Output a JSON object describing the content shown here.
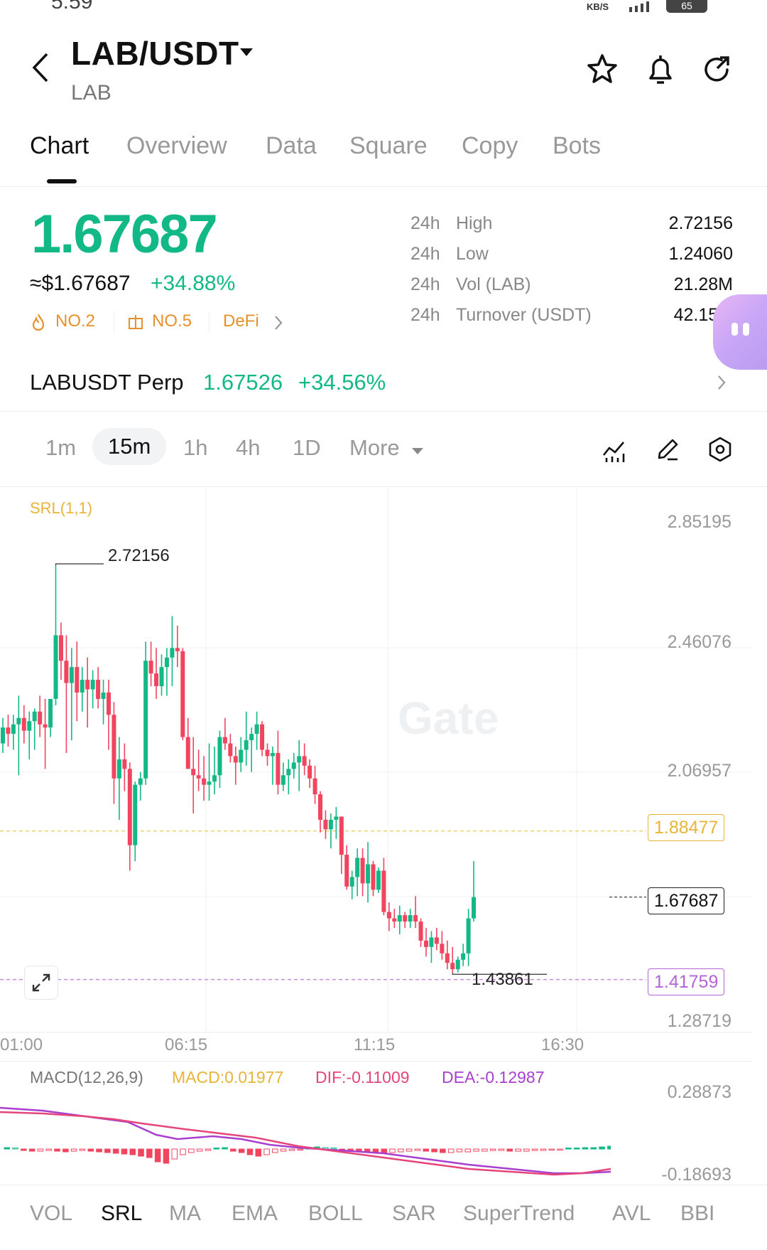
{
  "status_bar": {
    "time": "5:59",
    "network": "KB/S",
    "battery": "65"
  },
  "header": {
    "pair": "LAB/USDT",
    "base": "LAB",
    "icons": [
      "back-arrow-icon",
      "star-icon",
      "bell-icon",
      "share-icon"
    ]
  },
  "tabs": [
    "Chart",
    "Overview",
    "Data",
    "Square",
    "Copy",
    "Bots"
  ],
  "active_tab": "Chart",
  "ticker": {
    "price": "1.67687",
    "usd_price": "≈$1.67687",
    "change": "+34.88%",
    "ranks": [
      "NO.2",
      "NO.5",
      "DeFi"
    ],
    "stats": [
      {
        "period": "24h",
        "label": "High",
        "value": "2.72156"
      },
      {
        "period": "24h",
        "label": "Low",
        "value": "1.24060"
      },
      {
        "period": "24h",
        "label": "Vol (LAB)",
        "value": "21.28M"
      },
      {
        "period": "24h",
        "label": "Turnover (USDT)",
        "value": "42.15M"
      }
    ]
  },
  "perp": {
    "name": "LABUSDT Perp",
    "price": "1.67526",
    "change": "+34.56%"
  },
  "intervals": [
    "1m",
    "15m",
    "1h",
    "4h",
    "1D",
    "More"
  ],
  "active_interval": "15m",
  "chart": {
    "indicator": "SRL(1,1)",
    "y_ticks": [
      "2.85195",
      "2.46076",
      "2.06957",
      "1.28719"
    ],
    "x_ticks": [
      "01:00",
      "06:15",
      "11:15",
      "16:30"
    ],
    "tags": {
      "srl_upper": "1.88477",
      "last": "1.67687",
      "srl_lower": "1.41759"
    },
    "annotations": {
      "high": "2.72156",
      "low": "1.43861"
    },
    "watermark": "Gate"
  },
  "chart_data": {
    "type": "candlestick",
    "ylim": [
      1.28719,
      2.85195
    ],
    "x_ticks": [
      "01:00",
      "06:15",
      "11:15",
      "16:30"
    ],
    "colors": {
      "up": "#12b886",
      "down": "#f0445f"
    },
    "candles": [
      [
        2.16,
        2.24,
        2.13,
        2.21
      ],
      [
        2.21,
        2.25,
        2.15,
        2.19
      ],
      [
        2.19,
        2.25,
        2.14,
        2.22
      ],
      [
        2.22,
        2.31,
        2.06,
        2.24
      ],
      [
        2.24,
        2.28,
        2.16,
        2.2
      ],
      [
        2.2,
        2.26,
        2.11,
        2.23
      ],
      [
        2.23,
        2.27,
        2.14,
        2.26
      ],
      [
        2.26,
        2.31,
        2.18,
        2.22
      ],
      [
        2.22,
        2.3,
        2.08,
        2.21
      ],
      [
        2.21,
        2.26,
        2.18,
        2.3
      ],
      [
        2.3,
        2.72,
        2.28,
        2.5
      ],
      [
        2.5,
        2.54,
        2.36,
        2.42
      ],
      [
        2.42,
        2.5,
        2.13,
        2.35
      ],
      [
        2.35,
        2.46,
        2.17,
        2.4
      ],
      [
        2.4,
        2.48,
        2.23,
        2.32
      ],
      [
        2.32,
        2.4,
        2.26,
        2.36
      ],
      [
        2.36,
        2.43,
        2.21,
        2.33
      ],
      [
        2.33,
        2.39,
        2.27,
        2.36
      ],
      [
        2.36,
        2.4,
        2.27,
        2.3
      ],
      [
        2.3,
        2.36,
        2.22,
        2.32
      ],
      [
        2.32,
        2.36,
        2.14,
        2.25
      ],
      [
        2.25,
        2.29,
        1.97,
        2.05
      ],
      [
        2.05,
        2.18,
        1.92,
        2.11
      ],
      [
        2.11,
        2.16,
        2.01,
        2.08
      ],
      [
        2.08,
        2.1,
        1.76,
        1.84
      ],
      [
        1.84,
        2.04,
        1.79,
        2.03
      ],
      [
        2.03,
        2.07,
        1.98,
        2.05
      ],
      [
        2.05,
        2.48,
        2.03,
        2.42
      ],
      [
        2.42,
        2.48,
        2.34,
        2.38
      ],
      [
        2.38,
        2.46,
        2.3,
        2.34
      ],
      [
        2.34,
        2.44,
        2.31,
        2.4
      ],
      [
        2.4,
        2.46,
        2.31,
        2.43
      ],
      [
        2.43,
        2.56,
        2.34,
        2.46
      ],
      [
        2.46,
        2.53,
        2.4,
        2.45
      ],
      [
        2.45,
        2.46,
        2.17,
        2.18
      ],
      [
        2.18,
        2.24,
        2.08,
        2.08
      ],
      [
        2.08,
        2.18,
        1.94,
        2.06
      ],
      [
        2.06,
        2.14,
        2.01,
        2.05
      ],
      [
        2.05,
        2.12,
        1.98,
        2.03
      ],
      [
        2.03,
        2.16,
        1.98,
        2.04
      ],
      [
        2.04,
        2.15,
        2.0,
        2.06
      ],
      [
        2.06,
        2.2,
        2.02,
        2.18
      ],
      [
        2.18,
        2.24,
        2.14,
        2.16
      ],
      [
        2.16,
        2.19,
        2.1,
        2.12
      ],
      [
        2.12,
        2.15,
        2.03,
        2.1
      ],
      [
        2.1,
        2.18,
        2.07,
        2.14
      ],
      [
        2.14,
        2.26,
        2.09,
        2.17
      ],
      [
        2.17,
        2.21,
        2.07,
        2.19
      ],
      [
        2.19,
        2.26,
        2.14,
        2.22
      ],
      [
        2.22,
        2.23,
        2.12,
        2.14
      ],
      [
        2.14,
        2.16,
        2.09,
        2.12
      ],
      [
        2.12,
        2.15,
        2.03,
        2.13
      ],
      [
        2.13,
        2.2,
        2.0,
        2.03
      ],
      [
        2.03,
        2.1,
        2.01,
        2.06
      ],
      [
        2.06,
        2.11,
        2.0,
        2.08
      ],
      [
        2.08,
        2.13,
        2.05,
        2.1
      ],
      [
        2.1,
        2.17,
        2.01,
        2.12
      ],
      [
        2.12,
        2.16,
        2.06,
        2.09
      ],
      [
        2.09,
        2.11,
        2.02,
        2.05
      ],
      [
        2.05,
        2.09,
        1.97,
        2.0
      ],
      [
        2.0,
        2.01,
        1.88,
        1.92
      ],
      [
        1.92,
        1.95,
        1.86,
        1.89
      ],
      [
        1.89,
        1.94,
        1.83,
        1.92
      ],
      [
        1.92,
        1.96,
        1.86,
        1.93
      ],
      [
        1.93,
        1.93,
        1.75,
        1.81
      ],
      [
        1.81,
        1.84,
        1.7,
        1.71
      ],
      [
        1.71,
        1.76,
        1.67,
        1.74
      ],
      [
        1.74,
        1.83,
        1.68,
        1.8
      ],
      [
        1.8,
        1.83,
        1.68,
        1.72
      ],
      [
        1.72,
        1.85,
        1.66,
        1.78
      ],
      [
        1.78,
        1.79,
        1.68,
        1.7
      ],
      [
        1.7,
        1.77,
        1.69,
        1.76
      ],
      [
        1.76,
        1.8,
        1.62,
        1.63
      ],
      [
        1.63,
        1.66,
        1.57,
        1.61
      ],
      [
        1.61,
        1.64,
        1.58,
        1.6
      ],
      [
        1.6,
        1.65,
        1.56,
        1.62
      ],
      [
        1.62,
        1.63,
        1.58,
        1.6
      ],
      [
        1.6,
        1.64,
        1.58,
        1.62
      ],
      [
        1.62,
        1.68,
        1.58,
        1.6
      ],
      [
        1.6,
        1.61,
        1.52,
        1.54
      ],
      [
        1.54,
        1.58,
        1.49,
        1.52
      ],
      [
        1.52,
        1.57,
        1.47,
        1.55
      ],
      [
        1.55,
        1.58,
        1.51,
        1.53
      ],
      [
        1.53,
        1.57,
        1.48,
        1.5
      ],
      [
        1.5,
        1.54,
        1.45,
        1.47
      ],
      [
        1.47,
        1.52,
        1.43861,
        1.45
      ],
      [
        1.45,
        1.49,
        1.44,
        1.48
      ],
      [
        1.48,
        1.53,
        1.46,
        1.5
      ],
      [
        1.5,
        1.64,
        1.46,
        1.61
      ],
      [
        1.61,
        1.79,
        1.6,
        1.67687
      ]
    ],
    "srl_levels": [
      1.88477,
      1.41759
    ],
    "last_price": 1.67687
  },
  "macd": {
    "label": "MACD(12,26,9)",
    "macd": "MACD:0.01977",
    "dif": "DIF:-0.11009",
    "dea": "DEA:-0.12987",
    "y_ticks": [
      "0.28873",
      "-0.18693"
    ]
  },
  "indicators": [
    "VOL",
    "SRL",
    "MA",
    "EMA",
    "BOLL",
    "SAR",
    "SuperTrend",
    "AVL",
    "BBI"
  ],
  "active_indicator": "SRL"
}
